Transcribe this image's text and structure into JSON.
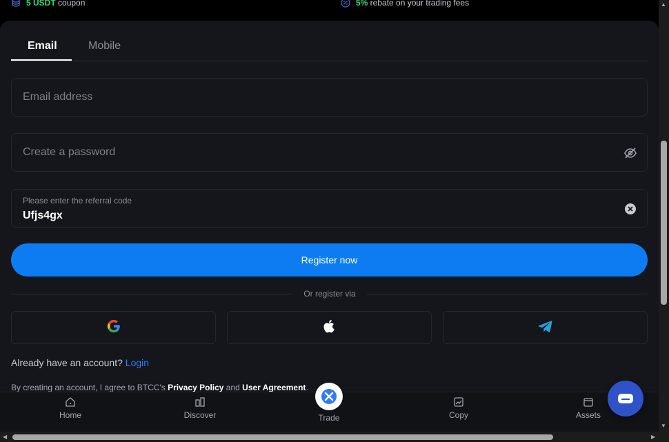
{
  "promo": {
    "left": {
      "highlight": "5 USDT",
      "text": " coupon"
    },
    "right": {
      "highlight": "5%",
      "text": " rebate on your trading fees"
    }
  },
  "tabs": [
    {
      "label": "Email",
      "active": true
    },
    {
      "label": "Mobile",
      "active": false
    }
  ],
  "form": {
    "email_placeholder": "Email address",
    "password_placeholder": "Create a password",
    "referral_label": "Please enter the referral code",
    "referral_value": "Ufjs4gx",
    "register_label": "Register now",
    "or_register_via": "Or register via"
  },
  "social": [
    "google-icon",
    "apple-icon",
    "telegram-icon"
  ],
  "account": {
    "prompt": "Already have an account?",
    "login_label": "Login"
  },
  "terms": {
    "prefix": "By creating an account, I agree to BTCC's ",
    "privacy": "Privacy Policy",
    "and": " and ",
    "agreement": "User Agreement",
    "suffix": "."
  },
  "bottom_nav": [
    {
      "label": "Home",
      "icon": "home-icon"
    },
    {
      "label": "Discover",
      "icon": "discover-icon"
    },
    {
      "label": "Trade",
      "icon": "trade-icon"
    },
    {
      "label": "Copy",
      "icon": "copy-icon"
    },
    {
      "label": "Assets",
      "icon": "wallet-icon"
    }
  ],
  "colors": {
    "accent": "#0d7cf2",
    "highlight_green": "#37d67a",
    "link_blue": "#2f7df6",
    "chat_blue": "#2f52c9",
    "card_bg": "#14161b"
  }
}
